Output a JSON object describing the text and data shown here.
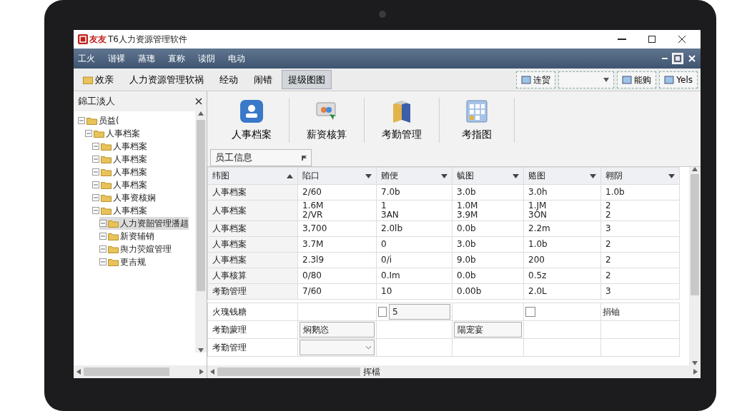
{
  "window": {
    "brand": "友友",
    "title": "T6人力资源管理软件"
  },
  "menu": [
    "工火",
    "谐裸",
    "蒸璁",
    "直称",
    "读阴",
    "电动"
  ],
  "toolbar": {
    "left": [
      {
        "label": "效亲",
        "selected": false
      },
      {
        "label": "人力资源管理软祸",
        "selected": false
      },
      {
        "label": "经动",
        "selected": false
      },
      {
        "label": "闹错",
        "selected": false
      },
      {
        "label": "提级图图",
        "selected": true
      }
    ],
    "right": [
      {
        "kind": "button",
        "label": "连贸"
      },
      {
        "kind": "select"
      },
      {
        "kind": "button",
        "label": "能购"
      },
      {
        "kind": "button",
        "label": "Yels"
      }
    ]
  },
  "sidebar": {
    "title": "錦工淡人",
    "tree": [
      {
        "label": "员益(",
        "selected": false,
        "children": [
          {
            "label": "人事档案",
            "selected": false,
            "children": [
              {
                "label": "人事档案",
                "selected": false
              },
              {
                "label": "人事档案",
                "selected": false
              },
              {
                "label": "人事档案",
                "selected": false
              },
              {
                "label": "人事档案",
                "selected": false
              },
              {
                "label": "人事资核娴",
                "selected": false
              },
              {
                "label": "人事档案",
                "selected": false,
                "children": [
                  {
                    "label": "人力资韶管理潘趄",
                    "selected": true
                  },
                  {
                    "label": "新资辅销",
                    "selected": false
                  },
                  {
                    "label": "舆力荧媗管理",
                    "selected": false
                  },
                  {
                    "label": "更吉规",
                    "selected": false
                  }
                ]
              }
            ]
          }
        ]
      }
    ]
  },
  "modules": [
    {
      "kind": "person",
      "label": "人事档案"
    },
    {
      "kind": "cards",
      "label": "薪资核算"
    },
    {
      "kind": "book",
      "label": "考勤管理"
    },
    {
      "kind": "grid",
      "label": "考指图"
    }
  ],
  "tab": "员工信息",
  "table": {
    "columns": [
      "纬图",
      "陷口",
      "贿便",
      "毓图",
      "赂图",
      "翱阴"
    ],
    "rows": [
      [
        "人事档案",
        "2/60",
        "7.0b",
        "3.0b",
        "3.0h",
        "1.0b"
      ],
      [
        "人事档案",
        "1.6M\n2/VR",
        "1\n3AN",
        "1.0M\n3.9M",
        "1.JM\n3ON",
        "2\n2"
      ],
      [
        "人事档案",
        "3,700",
        "2.0lb",
        "0.0b",
        "2.2m",
        "3"
      ],
      [
        "人事档案",
        "3.7M",
        "0",
        "3.0b",
        "1.0b",
        "2"
      ],
      [
        "人事档案",
        "2.3l9",
        "0/i",
        "9.0b",
        "200",
        "2"
      ],
      [
        "人事核算",
        "0/80",
        "0.Im",
        "0.0b",
        "0.5z",
        "2"
      ],
      [
        "考勤管理",
        "7/60",
        "10",
        "0.00b",
        "2.0L",
        "3"
      ]
    ]
  },
  "form": [
    {
      "label": "火瑰钱糖",
      "cells": [
        {
          "kind": "empty"
        },
        {
          "kind": "check",
          "checked": false,
          "value": "5"
        },
        {
          "kind": "empty"
        },
        {
          "kind": "check",
          "checked": false
        },
        {
          "kind": "text",
          "value": "捐铀"
        }
      ]
    },
    {
      "label": "考勤蒙理",
      "cells": [
        {
          "kind": "field",
          "value": "焖鹅恣"
        },
        {
          "kind": "empty"
        },
        {
          "kind": "field",
          "value": "陽宠宴"
        },
        {
          "kind": "empty"
        },
        {
          "kind": "empty"
        }
      ]
    },
    {
      "label": "考勤管理",
      "cells": [
        {
          "kind": "select"
        },
        {
          "kind": "empty"
        },
        {
          "kind": "empty"
        },
        {
          "kind": "empty"
        },
        {
          "kind": "empty"
        }
      ]
    }
  ],
  "hscroll_label": "挥檔"
}
